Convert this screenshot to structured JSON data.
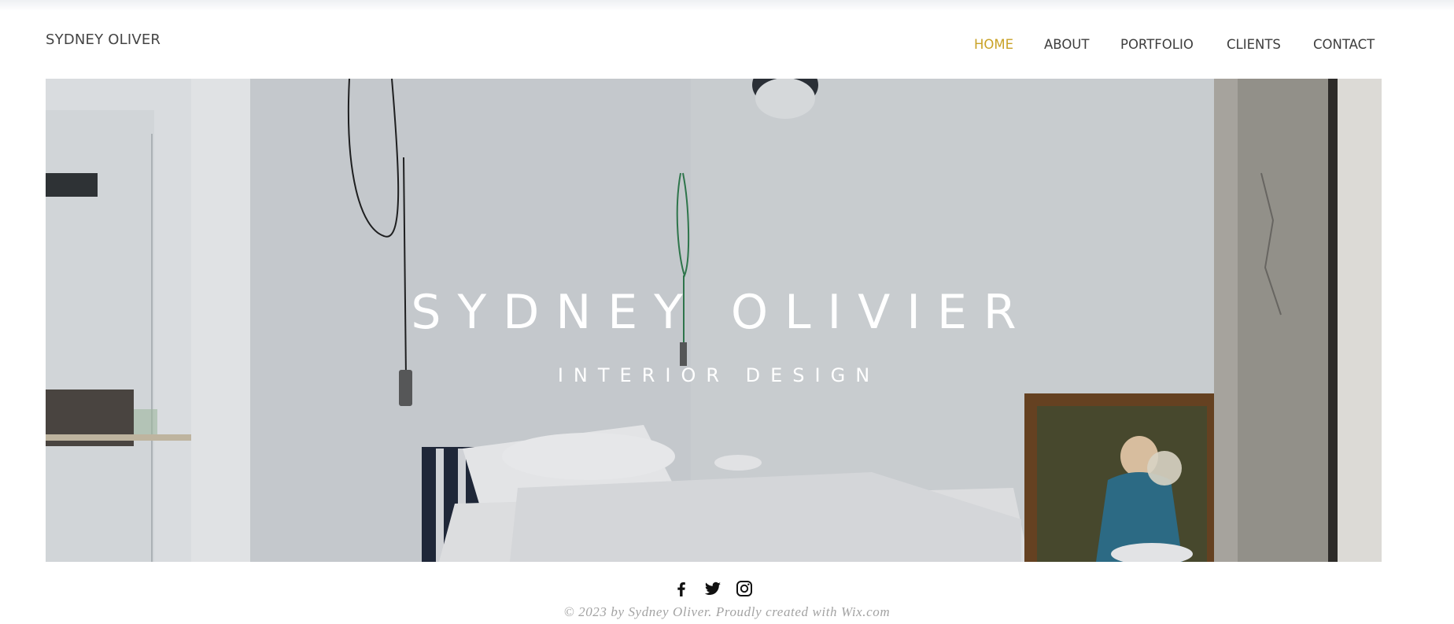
{
  "site": {
    "logo": "SYDNEY OLIVER"
  },
  "nav": {
    "items": [
      {
        "label": "HOME",
        "active": true
      },
      {
        "label": "ABOUT"
      },
      {
        "label": "PORTFOLIO"
      },
      {
        "label": "CLIENTS"
      },
      {
        "label": "CONTACT"
      }
    ],
    "active_color": "#c9a227",
    "text_color": "#3d3d3d"
  },
  "hero": {
    "title": "SYDNEY OLIVIER",
    "subtitle": "INTERIOR DESIGN",
    "image_description_icon": "bedroom-photo"
  },
  "social": {
    "icons": [
      "facebook-icon",
      "twitter-icon",
      "instagram-icon"
    ]
  },
  "footer": {
    "text": "© 2023 by Sydney Oliver. Proudly created with Wix.com"
  }
}
